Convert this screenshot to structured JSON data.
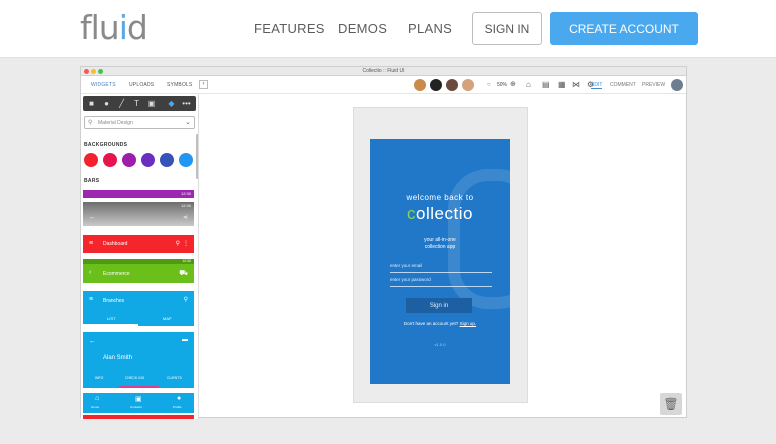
{
  "site": {
    "logo": {
      "pre": "flu",
      "i": "i",
      "post": "d"
    },
    "nav": [
      "FEATURES",
      "DEMOS",
      "PLANS"
    ],
    "sign_in": "SIGN IN",
    "create_account": "CREATE ACCOUNT"
  },
  "app": {
    "window_title": "Collectio :: Fluid UI",
    "left_tabs": [
      "WIDGETS",
      "UPLOADS",
      "SYMBOLS"
    ],
    "zoom": "50%",
    "modes": [
      "EDIT",
      "COMMENT",
      "PREVIEW"
    ],
    "library_dropdown": "Material Design",
    "backgrounds_label": "BACKGROUNDS",
    "bars_label": "BARS",
    "swatch_colors": [
      "#f2232f",
      "#e8144e",
      "#9b1faa",
      "#6a2ec0",
      "#3553b8",
      "#2196f3"
    ],
    "bars": [
      {
        "name": "purple-bar",
        "color": "#9c27b0",
        "time": "12:30"
      },
      {
        "name": "grey-bar",
        "color": "#8e8e8e",
        "time": "12:30"
      },
      {
        "name": "dashboard-bar",
        "color": "#f4262b",
        "label": "Dashboard"
      },
      {
        "name": "ecommerce-bar",
        "color": "#6bbf1b",
        "label": "Ecommerce",
        "time": "12:30"
      },
      {
        "name": "branches-bar",
        "color": "#10a9e6",
        "label": "Branches",
        "tabs": [
          "LIST",
          "MAP"
        ]
      },
      {
        "name": "profile-bar",
        "color": "#10a9e6",
        "label": "Alan Smith",
        "tabs": [
          "INFO",
          "CHECK INS",
          "CLIENTS"
        ]
      },
      {
        "name": "bottom-nav-bar",
        "color": "#10a9e6",
        "tabs": [
          "Home",
          "Contacts",
          "Profile"
        ]
      }
    ]
  },
  "phone_screen": {
    "welcome": "welcome back to",
    "brand_c": "c",
    "brand_rest": "ollectio",
    "tagline1": "your all-in-one",
    "tagline2": "collection app",
    "email_placeholder": "enter your email",
    "password_placeholder": "enter your password",
    "sign_in": "Sign in",
    "no_account": "Don't have an account yet?",
    "sign_up": "Sign up.",
    "version": "v1.0.0"
  },
  "colors": {
    "accent": "#4aa8ee",
    "phone_bg": "#2178c9",
    "brand_c": "#8ad44a"
  }
}
